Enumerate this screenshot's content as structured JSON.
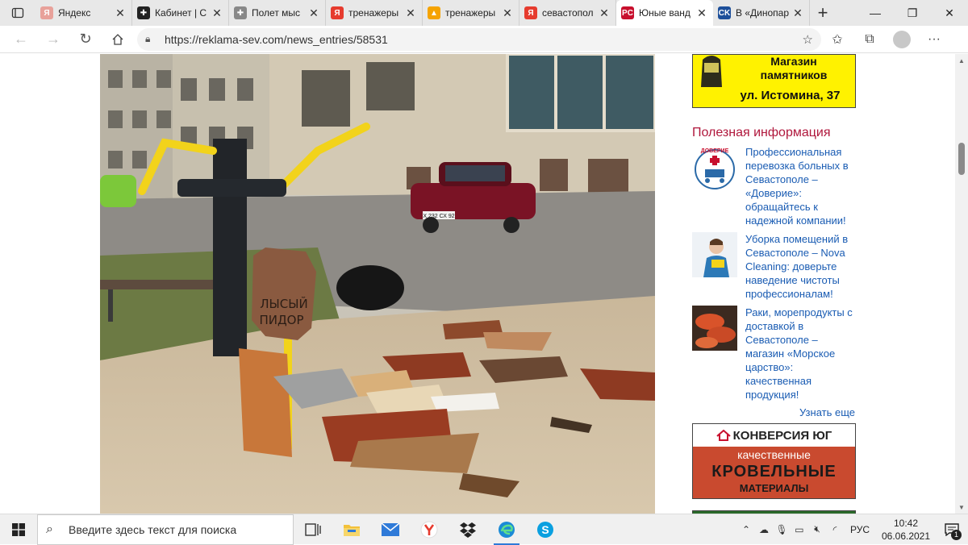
{
  "tabs": [
    {
      "title": "Яндекс",
      "fav_color": "#e8a19a",
      "fav_glyph": "Я",
      "active": false
    },
    {
      "title": "Кабинет | С",
      "fav_color": "#222222",
      "fav_glyph": "✚",
      "active": false
    },
    {
      "title": "Полет мыс",
      "fav_color": "#888888",
      "fav_glyph": "✚",
      "active": false
    },
    {
      "title": "тренажеры",
      "fav_color": "#e63b2e",
      "fav_glyph": "Я",
      "active": false
    },
    {
      "title": "тренажеры",
      "fav_color": "#f5a300",
      "fav_glyph": "▲",
      "active": false
    },
    {
      "title": "севастопол",
      "fav_color": "#e63b2e",
      "fav_glyph": "Я",
      "active": false
    },
    {
      "title": "Юные ванд",
      "fav_color": "#c8102e",
      "fav_glyph": "PC",
      "active": true
    },
    {
      "title": "В «Динопар",
      "fav_color": "#1d4f9a",
      "fav_glyph": "CK",
      "active": false
    }
  ],
  "toolbar": {
    "url": "https://reklama-sev.com/news_entries/58531"
  },
  "sidebar": {
    "ad1": {
      "line1": "Магазин памятников",
      "line2": "ул. Истомина, 37"
    },
    "heading": "Полезная информация",
    "items": [
      {
        "text": "Профессиональная перевозка больных в Севастополе – «Доверие»: обращайтесь к надежной компании!",
        "thumb": "doverie",
        "thumb_label": "ДОВЕРИЕ"
      },
      {
        "text": "Уборка помещений в Севастополе – Nova Cleaning: доверьте наведение чистоты профессионалам!",
        "thumb": "cleaning"
      },
      {
        "text": "Раки, морепродукты с доставкой в Севастополе – магазин «Морское царство»: качественная продукция!",
        "thumb": "seafood"
      }
    ],
    "more": "Узнать еще",
    "ad2": {
      "brand": "КОНВЕРСИЯ ЮГ",
      "mid": "качественные",
      "big": "КРОВЕЛЬНЫЕ",
      "small": "МАТЕРИАЛЫ"
    }
  },
  "photo": {
    "board_text_1": "ЛЫСЫЙ",
    "board_text_2": "ПИДОР",
    "plate": "Х 232 СХ 92"
  },
  "taskbar": {
    "search_placeholder": "Введите здесь текст для поиска",
    "lang": "РУС",
    "time": "10:42",
    "date": "06.06.2021",
    "notifications": "1"
  },
  "colors": {
    "accent": "#b0173c",
    "link": "#1a5cb3",
    "taskbar_accent": "#2f7ad8"
  }
}
